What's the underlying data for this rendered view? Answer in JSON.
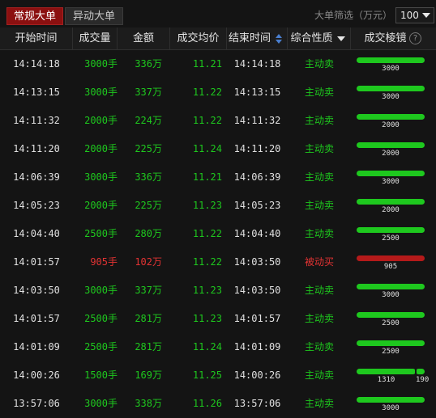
{
  "tabs": [
    {
      "label": "常规大单",
      "active": true
    },
    {
      "label": "异动大单",
      "active": false
    }
  ],
  "filter": {
    "label": "大单筛选（万元）",
    "value": "100"
  },
  "columns": [
    "开始时间",
    "成交量",
    "金额",
    "成交均价",
    "结束时间",
    "综合性质",
    "成交棱镜"
  ],
  "colors": {
    "buy": "#1ec81e",
    "sell": "#e33333",
    "sell_bar": "#b51a1a",
    "active_tab": "#8b1010"
  },
  "rows": [
    {
      "start": "14:14:18",
      "volume": "3000手",
      "amount": "336万",
      "price": "11.21",
      "end": "14:14:18",
      "nature": "主动卖",
      "side": "green",
      "bars": [
        {
          "value": 3000,
          "label": "3000"
        }
      ]
    },
    {
      "start": "14:13:15",
      "volume": "3000手",
      "amount": "337万",
      "price": "11.22",
      "end": "14:13:15",
      "nature": "主动卖",
      "side": "green",
      "bars": [
        {
          "value": 3000,
          "label": "3000"
        }
      ]
    },
    {
      "start": "14:11:32",
      "volume": "2000手",
      "amount": "224万",
      "price": "11.22",
      "end": "14:11:32",
      "nature": "主动卖",
      "side": "green",
      "bars": [
        {
          "value": 2000,
          "label": "2000"
        }
      ]
    },
    {
      "start": "14:11:20",
      "volume": "2000手",
      "amount": "225万",
      "price": "11.24",
      "end": "14:11:20",
      "nature": "主动卖",
      "side": "green",
      "bars": [
        {
          "value": 2000,
          "label": "2000"
        }
      ]
    },
    {
      "start": "14:06:39",
      "volume": "3000手",
      "amount": "336万",
      "price": "11.21",
      "end": "14:06:39",
      "nature": "主动卖",
      "side": "green",
      "bars": [
        {
          "value": 3000,
          "label": "3000"
        }
      ]
    },
    {
      "start": "14:05:23",
      "volume": "2000手",
      "amount": "225万",
      "price": "11.23",
      "end": "14:05:23",
      "nature": "主动卖",
      "side": "green",
      "bars": [
        {
          "value": 2000,
          "label": "2000"
        }
      ]
    },
    {
      "start": "14:04:40",
      "volume": "2500手",
      "amount": "280万",
      "price": "11.22",
      "end": "14:04:40",
      "nature": "主动卖",
      "side": "green",
      "bars": [
        {
          "value": 2500,
          "label": "2500"
        }
      ]
    },
    {
      "start": "14:01:57",
      "volume": "905手",
      "amount": "102万",
      "price": "11.22",
      "end": "14:03:50",
      "nature": "被动买",
      "side": "red",
      "bars": [
        {
          "value": 905,
          "label": "905"
        }
      ]
    },
    {
      "start": "14:03:50",
      "volume": "3000手",
      "amount": "337万",
      "price": "11.23",
      "end": "14:03:50",
      "nature": "主动卖",
      "side": "green",
      "bars": [
        {
          "value": 3000,
          "label": "3000"
        }
      ]
    },
    {
      "start": "14:01:57",
      "volume": "2500手",
      "amount": "281万",
      "price": "11.23",
      "end": "14:01:57",
      "nature": "主动卖",
      "side": "green",
      "bars": [
        {
          "value": 2500,
          "label": "2500"
        }
      ]
    },
    {
      "start": "14:01:09",
      "volume": "2500手",
      "amount": "281万",
      "price": "11.24",
      "end": "14:01:09",
      "nature": "主动卖",
      "side": "green",
      "bars": [
        {
          "value": 2500,
          "label": "2500"
        }
      ]
    },
    {
      "start": "14:00:26",
      "volume": "1500手",
      "amount": "169万",
      "price": "11.25",
      "end": "14:00:26",
      "nature": "主动卖",
      "side": "green",
      "bars": [
        {
          "value": 1310,
          "label": "1310"
        },
        {
          "value": 190,
          "label": "190"
        }
      ]
    },
    {
      "start": "13:57:06",
      "volume": "3000手",
      "amount": "338万",
      "price": "11.26",
      "end": "13:57:06",
      "nature": "主动卖",
      "side": "green",
      "bars": [
        {
          "value": 3000,
          "label": "3000"
        }
      ]
    }
  ]
}
